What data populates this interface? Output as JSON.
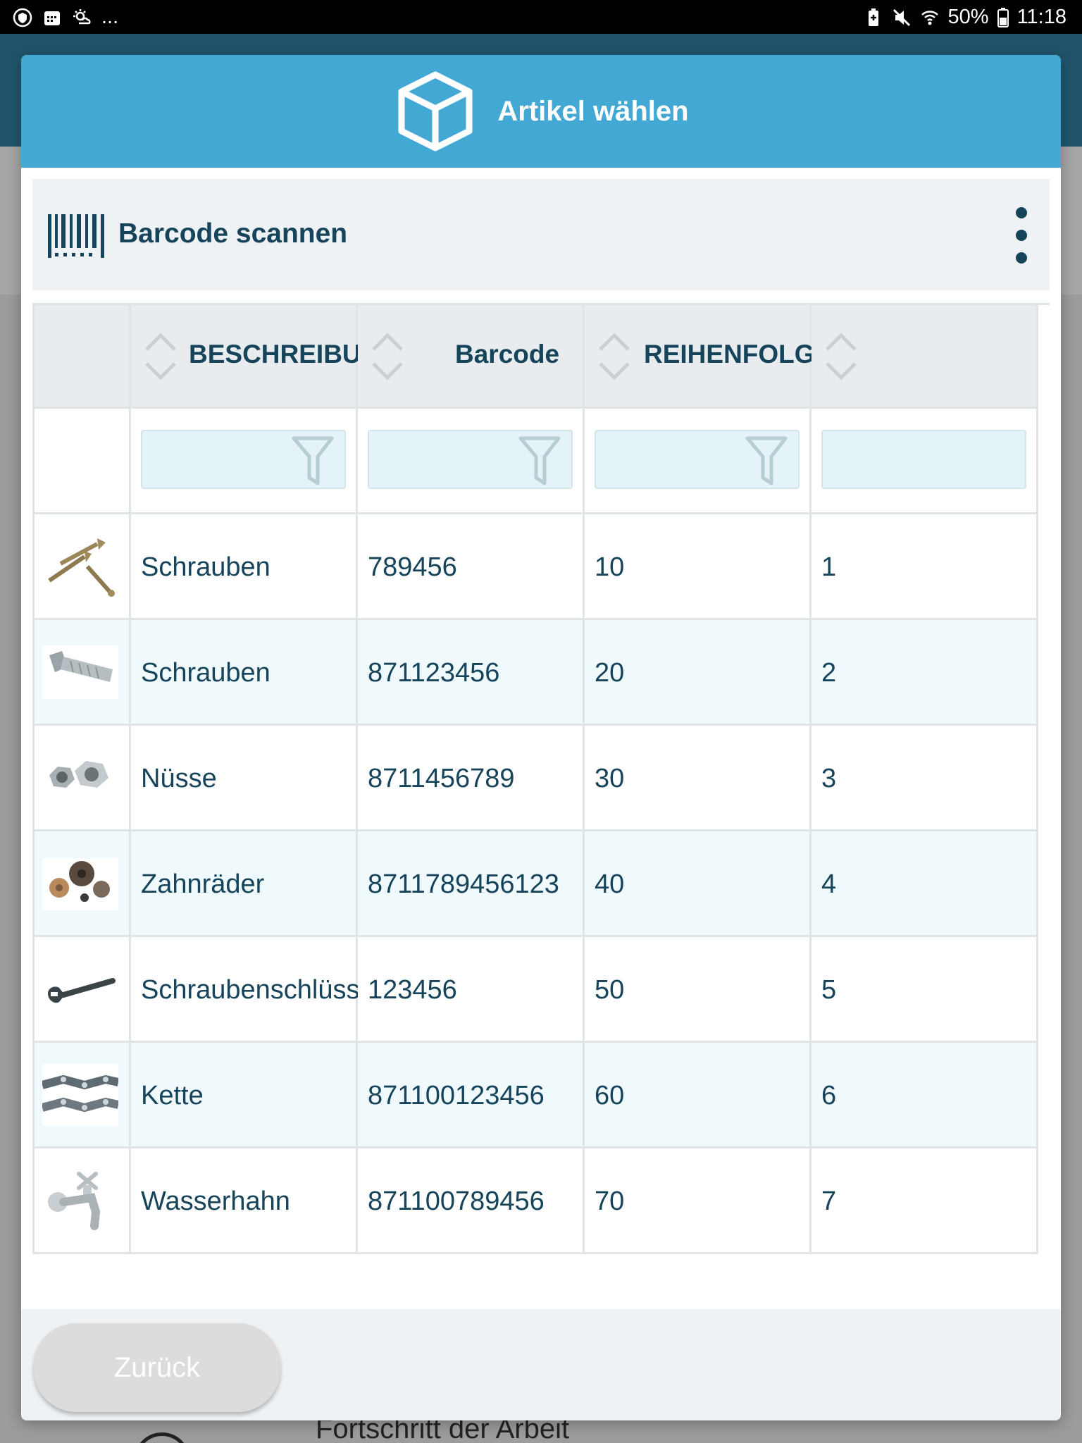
{
  "statusbar": {
    "battery": "50%",
    "time": "11:18",
    "more": "..."
  },
  "modal": {
    "title": "Artikel wählen",
    "title_icon": "package-box-icon"
  },
  "barcode": {
    "label": "Barcode scannen",
    "icon": "barcode-icon",
    "menu_icon": "kebab-menu-icon"
  },
  "table": {
    "columns": [
      {
        "label": ""
      },
      {
        "label": "BESCHREIBUNG"
      },
      {
        "label": "Barcode"
      },
      {
        "label": "REIHENFOLGE..."
      }
    ],
    "rows": [
      {
        "thumb": "screws-image",
        "beschreibung": "Schrauben",
        "barcode": "789456",
        "reihenfolge": "10",
        "extra": "1"
      },
      {
        "thumb": "bolt-image",
        "beschreibung": "Schrauben",
        "barcode": "871123456",
        "reihenfolge": "20",
        "extra": "2"
      },
      {
        "thumb": "nuts-image",
        "beschreibung": "Nüsse",
        "barcode": "8711456789",
        "reihenfolge": "30",
        "extra": "3"
      },
      {
        "thumb": "gears-image",
        "beschreibung": "Zahnräder",
        "barcode": "8711789456123",
        "reihenfolge": "40",
        "extra": "4"
      },
      {
        "thumb": "wrench-image",
        "beschreibung": "Schraubenschlüssel",
        "barcode": "123456",
        "reihenfolge": "50",
        "extra": "5"
      },
      {
        "thumb": "chain-image",
        "beschreibung": "Kette",
        "barcode": "871100123456",
        "reihenfolge": "60",
        "extra": "6"
      },
      {
        "thumb": "faucet-image",
        "beschreibung": "Wasserhahn",
        "barcode": "871100789456",
        "reihenfolge": "70",
        "extra": "7"
      }
    ]
  },
  "footer": {
    "back_label": "Zurück"
  },
  "background": {
    "footer_text": "Fortschritt der Arbeit"
  },
  "colors": {
    "header": "#43a8d3",
    "text_dark": "#16445a",
    "row_alt": "#f0f9fc",
    "filter_bg": "#e4f3f8"
  }
}
